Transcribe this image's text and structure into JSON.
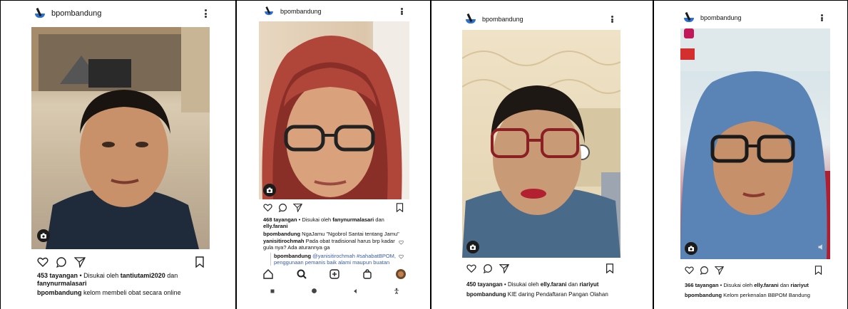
{
  "posts": [
    {
      "username": "bpombandung",
      "views": "453 tayangan",
      "liked_prefix": " • Disukai oleh ",
      "liked_a": "tantiutami2020",
      "liked_and": " dan",
      "liked_b": "fanynurmalasari",
      "cap_user": "bpombandung",
      "caption": " kelom membeli obat secara online"
    },
    {
      "username": "bpombandung",
      "views": "468 tayangan",
      "liked_prefix": " • Disukai oleh ",
      "liked_a": "fanynurmalasari",
      "liked_and": " dan",
      "liked_b": "elly.farani",
      "cap_user": "bpombandung",
      "caption": " NgaJamu \"Ngobrol Santai tentang Jamu\"",
      "c1_user": "yanisitirochmah",
      "c1_text": " Pada obat tradisional harus brp kadar gula nya? Ada aturannya ga",
      "c2_user": "bpombandung",
      "c2_text": " @yanisitirochmah #sahabatBPOM, penggunaan pemanis baik alami maupun buatan"
    },
    {
      "username": "bpombandung",
      "views": "450 tayangan",
      "liked_prefix": " • Disukai oleh ",
      "liked_a": "elly.farani",
      "liked_and": " dan ",
      "liked_b": "riariyut",
      "cap_user": "bpombandung",
      "caption": " KIE daring Pendaftaran Pangan Olahan"
    },
    {
      "username": "bpombandung",
      "views": "366 tayangan",
      "liked_prefix": " • Disukai oleh ",
      "liked_a": "elly.farani",
      "liked_and": " dan ",
      "liked_b": "riariyut",
      "cap_user": "bpombandung",
      "caption": " Kelom perkenalan BBPOM Bandung"
    }
  ],
  "icons": {
    "like": "heart-icon",
    "comment": "comment-icon",
    "share": "send-icon",
    "save": "bookmark-icon",
    "more": "more-vert-icon",
    "camera": "camera-icon",
    "nav": [
      "home-icon",
      "search-icon",
      "add-icon",
      "shop-icon",
      "profile-icon"
    ],
    "system": [
      "recents-icon",
      "home-button-icon",
      "back-icon",
      "accessibility-icon"
    ]
  },
  "colors": {
    "accent": "#2b6fd1",
    "text": "#111111"
  }
}
